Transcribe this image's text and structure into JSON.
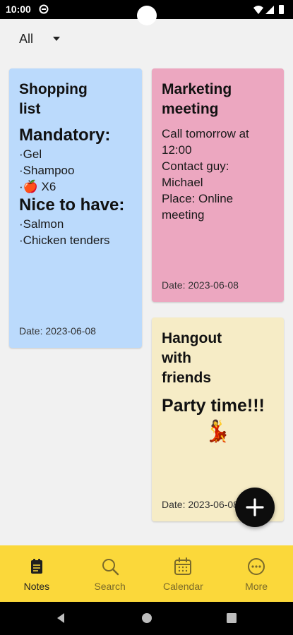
{
  "status_bar": {
    "time": "10:00"
  },
  "filter": {
    "label": "All"
  },
  "notes": [
    {
      "title": "Shopping\nlist",
      "heading1": "Mandatory:",
      "lines1": [
        "·Gel",
        "·Shampoo",
        "·🍎 X6"
      ],
      "heading2": "Nice to have:",
      "lines2": [
        "·Salmon",
        "·Chicken tenders"
      ],
      "date": "Date: 2023-06-08",
      "color": "#bbdafc"
    },
    {
      "title": "Marketing\nmeeting",
      "lines": [
        "Call tomorrow at",
        "12:00",
        "Contact guy:",
        "Michael",
        "Place: Online",
        "meeting"
      ],
      "date": "Date: 2023-06-08",
      "color": "#eca7c0"
    },
    {
      "title": "Hangout\nwith\nfriends",
      "heading": "Party time!!!",
      "emoji": "💃",
      "date": "Date: 2023-06-08",
      "color": "#f6ecc6"
    }
  ],
  "bottom_nav": {
    "items": [
      {
        "label": "Notes",
        "icon": "notes-icon",
        "active": true
      },
      {
        "label": "Search",
        "icon": "search-icon",
        "active": false
      },
      {
        "label": "Calendar",
        "icon": "calendar-icon",
        "active": false
      },
      {
        "label": "More",
        "icon": "more-icon",
        "active": false
      }
    ],
    "background": "#fbd83a"
  },
  "fab": {
    "icon": "plus-icon"
  }
}
